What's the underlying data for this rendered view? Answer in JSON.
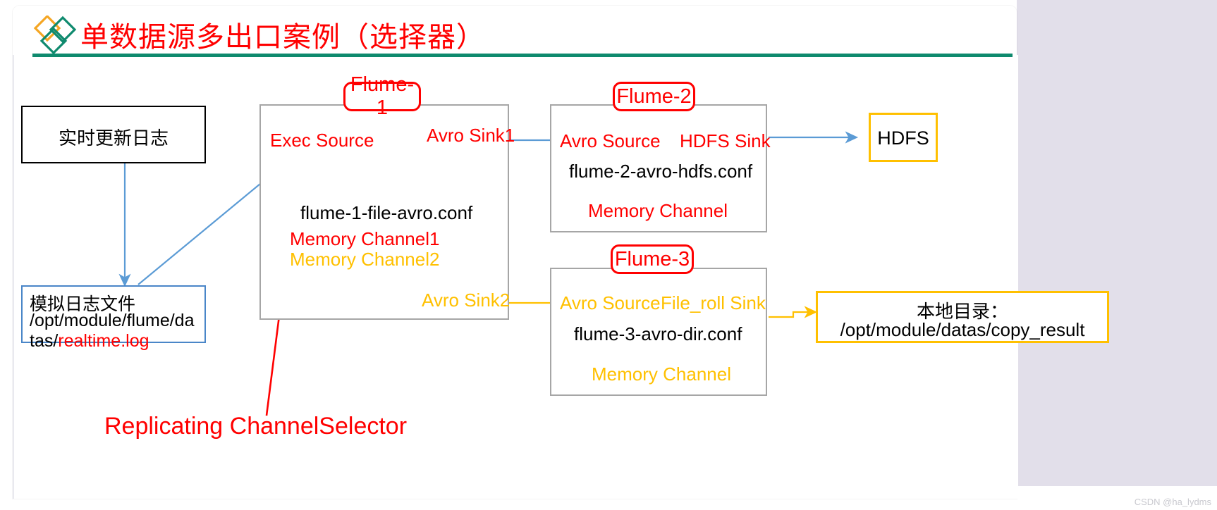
{
  "header": {
    "title": "单数据源多出口案例（选择器）",
    "logo_icon": "double-diamond-icon",
    "logo_color_1": "#f5a623",
    "logo_color_2": "#0f8a6e",
    "rule_color": "#0f8a6e",
    "title_color": "#ff0000"
  },
  "source": {
    "log_box_label": "实时更新日志",
    "file_box_line1": "模拟日志文件",
    "file_box_line2": "/opt/module/flume/da",
    "file_box_line3_prefix": "tas/",
    "file_box_line3_highlight": "realtime.log"
  },
  "flume1": {
    "tag": "Flume-1",
    "source": "Exec Source",
    "sink1": "Avro Sink1",
    "conf": "flume-1-file-avro.conf",
    "channel1": "Memory  Channel1",
    "channel2": "Memory  Channel2",
    "sink2": "Avro Sink2"
  },
  "flume2": {
    "tag": "Flume-2",
    "source": "Avro Source",
    "sink": "HDFS Sink",
    "conf": "flume-2-avro-hdfs.conf",
    "channel": "Memory Channel"
  },
  "flume3": {
    "tag": "Flume-3",
    "source": "Avro Source",
    "sink": "File_roll Sink",
    "conf": "flume-3-avro-dir.conf",
    "channel": "Memory Channel"
  },
  "sinks": {
    "hdfs_label": "HDFS",
    "local_dir_line1": "本地目录：",
    "local_dir_line2": "/opt/module/datas/copy_result"
  },
  "annotation": {
    "selector_label": "Replicating ChannelSelector"
  },
  "watermark": {
    "text": "CSDN @ha_lydms"
  },
  "colors": {
    "red": "#ff0000",
    "yellow": "#ffc000",
    "blue_arrow": "#5b9bd5",
    "gray_border": "#a6a6a6",
    "teal": "#0f8a6e",
    "lavender": "#e2dfea"
  }
}
